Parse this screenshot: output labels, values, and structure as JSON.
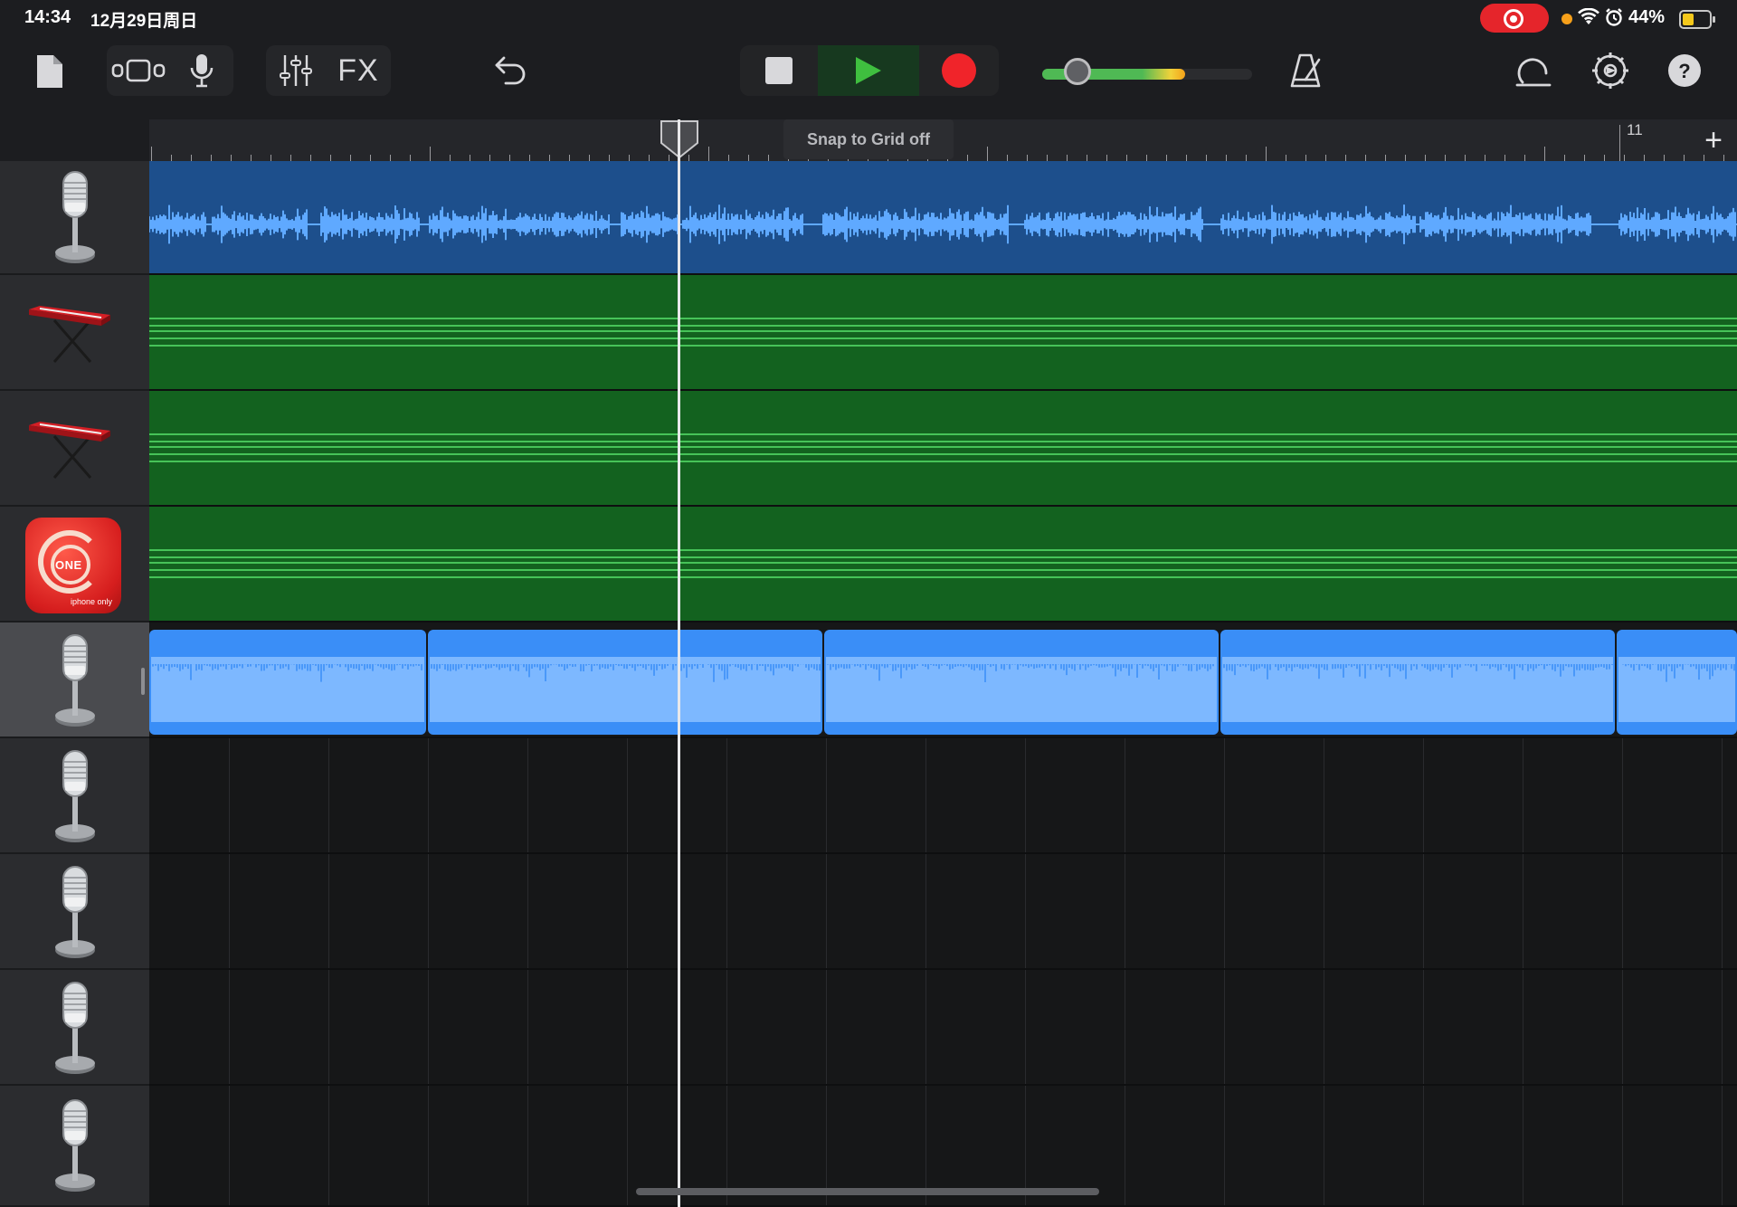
{
  "status_bar": {
    "time": "14:34",
    "date": "12月29日周日",
    "battery": "44%"
  },
  "toolbar": {
    "fx_label": "FX",
    "volume_level": 0.68
  },
  "ruler": {
    "snap_label": "Snap to Grid off",
    "bar_number": "11",
    "add_label": "+"
  },
  "tracks": [
    {
      "icon": "microphone-icon",
      "type": "audio",
      "region_color": "#1d4f8c"
    },
    {
      "icon": "keyboard-icon",
      "type": "midi",
      "region_color": "#13621f"
    },
    {
      "icon": "keyboard-icon",
      "type": "midi",
      "region_color": "#13621f"
    },
    {
      "icon": "one-app-icon",
      "type": "midi",
      "region_color": "#13621f",
      "app_label": "ONE",
      "app_sub": "iphone only"
    },
    {
      "icon": "microphone-icon",
      "type": "audio",
      "region_color": "#3a8ef7",
      "selected": true
    },
    {
      "icon": "microphone-icon",
      "type": "empty"
    },
    {
      "icon": "microphone-icon",
      "type": "empty"
    },
    {
      "icon": "microphone-icon",
      "type": "empty"
    },
    {
      "icon": "microphone-icon",
      "type": "empty"
    }
  ],
  "colors": {
    "play": "#3fbf3f",
    "record": "#f0242a",
    "accent_green": "#4fb954"
  }
}
